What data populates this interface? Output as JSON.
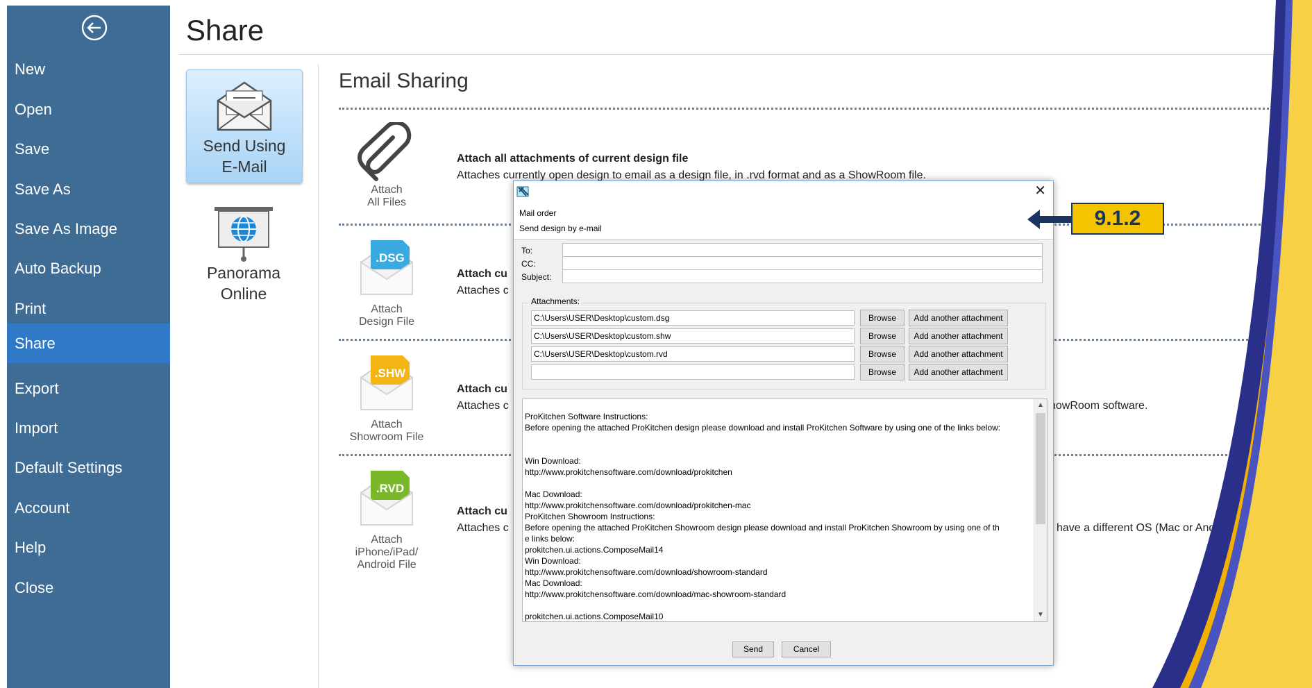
{
  "sidebar": {
    "items": [
      {
        "label": "New"
      },
      {
        "label": "Open"
      },
      {
        "label": "Save"
      },
      {
        "label": "Save As"
      },
      {
        "label": "Save As Image"
      },
      {
        "label": "Auto Backup"
      },
      {
        "label": "Print"
      },
      {
        "label": "Share",
        "active": true
      },
      {
        "label": "Export"
      },
      {
        "label": "Import"
      },
      {
        "label": "Default Settings"
      },
      {
        "label": "Account"
      },
      {
        "label": "Help"
      },
      {
        "label": "Close"
      }
    ],
    "back_icon": "back-arrow-icon",
    "bg_color": "#3e6c94",
    "active_color": "#2f79c6"
  },
  "header": {
    "title": "Share"
  },
  "share_options": [
    {
      "label_line1": "Send Using",
      "label_line2": "E-Mail",
      "icon": "email-icon",
      "selected": true
    },
    {
      "label_line1": "Panorama",
      "label_line2": "Online",
      "icon": "globe-presentation-icon",
      "selected": false
    }
  ],
  "email_sharing": {
    "title": "Email Sharing",
    "options": [
      {
        "icon": "paperclip-icon",
        "icon_line1": "Attach",
        "icon_line2": "All Files",
        "title": "Attach all attachments of current design file",
        "desc": "Attaches currently open design to email as a design file,  in .rvd format and as a ShowRoom file."
      },
      {
        "icon": "dsg-file-icon",
        "badge": ".DSG",
        "badge_color": "#3aa9e0",
        "icon_line1": "Attach",
        "icon_line2": "Design File",
        "title": "Attach cu",
        "desc": "Attaches c"
      },
      {
        "icon": "shw-file-icon",
        "badge": ".SHW",
        "badge_color": "#f2b514",
        "icon_line1": "Attach",
        "icon_line2": "Showroom File",
        "title": "Attach cu",
        "desc": "Attaches c",
        "desc_right": "howRoom software."
      },
      {
        "icon": "rvd-file-icon",
        "badge": ".RVD",
        "badge_color": "#79b828",
        "icon_line1": "Attach",
        "icon_line2": "iPhone/iPad/",
        "icon_line3": "Android File",
        "title": "Attach cu",
        "desc": "Attaches c",
        "desc_right": "have a different OS (Mac or Android)."
      }
    ]
  },
  "dialog": {
    "header_line1": "Mail order",
    "header_line2": "Send design by e-mail",
    "to_label": "To:",
    "cc_label": "CC:",
    "subject_label": "Subject:",
    "to_value": "",
    "cc_value": "",
    "subject_value": "",
    "attachments_label": "Attachments:",
    "attachments": [
      {
        "path": "C:\\Users\\USER\\Desktop\\custom.dsg"
      },
      {
        "path": "C:\\Users\\USER\\Desktop\\custom.shw"
      },
      {
        "path": "C:\\Users\\USER\\Desktop\\custom.rvd"
      },
      {
        "path": ""
      }
    ],
    "browse_label": "Browse",
    "add_label": "Add another attachment",
    "body": "ProKitchen Software Instructions:\nBefore opening the attached ProKitchen design please download and install ProKitchen Software by using one of the links below:\n\n\nWin Download:\nhttp://www.prokitchensoftware.com/download/prokitchen\n\nMac Download:\nhttp://www.prokitchensoftware.com/download/prokitchen-mac\nProKitchen Showroom Instructions:\nBefore opening the attached ProKitchen Showroom design please download and install ProKitchen Showroom by using one of th\ne links below:\nprokitchen.ui.actions.ComposeMail14\nWin Download:\nhttp://www.prokitchensoftware.com/download/showroom-standard\nMac Download:\nhttp://www.prokitchensoftware.com/download/mac-showroom-standard\n\nprokitchen.ui.actions.ComposeMail10",
    "send_label": "Send",
    "cancel_label": "Cancel",
    "close_symbol": "✕"
  },
  "callout": {
    "label": "9.1.2",
    "color": "#f5c400",
    "border": "#1b3560"
  }
}
